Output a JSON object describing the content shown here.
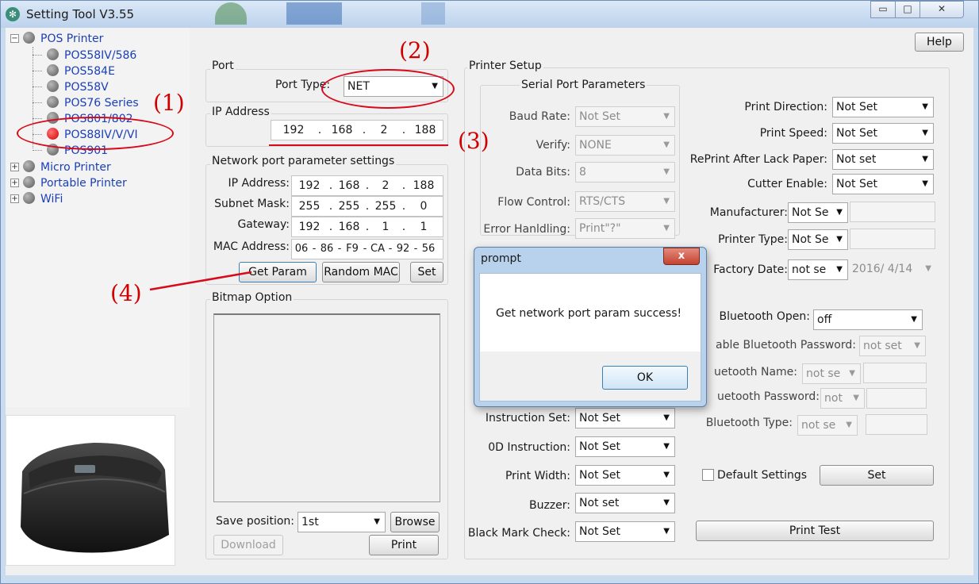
{
  "window": {
    "title": "Setting Tool V3.55",
    "minimize": "▭",
    "maximize": "□",
    "close": "✕",
    "help": "Help"
  },
  "tree": {
    "pos_printer": "POS Printer",
    "children": [
      "POS58IV/586",
      "POS584E",
      "POS58V",
      "POS76 Series",
      "POS801/802",
      "POS88IV/V/VI",
      "POS901"
    ],
    "micro_printer": "Micro Printer",
    "portable_printer": "Portable Printer",
    "wifi": "WiFi"
  },
  "port": {
    "title": "Port",
    "type_label": "Port Type:",
    "type_value": "NET"
  },
  "ip": {
    "title": "IP Address",
    "octets": [
      "192",
      "168",
      "2",
      "188"
    ]
  },
  "network": {
    "title": "Network port parameter settings",
    "ip_label": "IP Address:",
    "ip": [
      "192",
      "168",
      "2",
      "188"
    ],
    "subnet_label": "Subnet Mask:",
    "subnet": [
      "255",
      "255",
      "255",
      "0"
    ],
    "gateway_label": "Gateway:",
    "gateway": [
      "192",
      "168",
      "1",
      "1"
    ],
    "mac_label": "MAC Address:",
    "mac": [
      "06",
      "86",
      "F9",
      "CA",
      "92",
      "56"
    ],
    "get_param": "Get Param",
    "random_mac": "Random MAC",
    "set": "Set"
  },
  "bitmap": {
    "title": "Bitmap Option",
    "save_position_label": "Save position:",
    "save_position_value": "1st",
    "browse": "Browse",
    "download": "Download",
    "print": "Print"
  },
  "printer_setup": {
    "title": "Printer Setup",
    "serial_title": "Serial Port Parameters",
    "baud_label": "Baud Rate:",
    "baud_value": "Not Set",
    "verify_label": "Verify:",
    "verify_value": "NONE",
    "databits_label": "Data Bits:",
    "databits_value": "8",
    "flow_label": "Flow Control:",
    "flow_value": "RTS/CTS",
    "error_label": "Error Hanldling:",
    "error_value": "Print\"?\"",
    "instruction_label": "Instruction Set:",
    "instruction_value": "Not Set",
    "od_label": "0D Instruction:",
    "od_value": "Not Set",
    "width_label": "Print Width:",
    "width_value": "Not Set",
    "buzzer_label": "Buzzer:",
    "buzzer_value": "Not set",
    "blackmark_label": "Black Mark Check:",
    "blackmark_value": "Not Set",
    "direction_label": "Print Direction:",
    "direction_value": "Not Set",
    "speed_label": "Print Speed:",
    "speed_value": "Not Set",
    "reprint_label": "RePrint After Lack Paper:",
    "reprint_value": "Not set",
    "cutter_label": "Cutter Enable:",
    "cutter_value": "Not Set",
    "manufacturer_label": "Manufacturer:",
    "manufacturer_value": "Not Se",
    "type_label": "Printer Type:",
    "type_value": "Not Se",
    "factory_label": "Factory Date:",
    "factory_value": "not se",
    "factory_date": "2016/  4/14",
    "bt_open_label": "Bluetooth Open:",
    "bt_open_value": "off",
    "bt_enable_pw_label": "able Bluetooth Password:",
    "bt_enable_pw_value": "not set",
    "bt_name_label": "uetooth Name:",
    "bt_name_value": "not se",
    "bt_pw_label": "uetooth Password:",
    "bt_pw_value": "not",
    "bt_type_label": "Bluetooth Type:",
    "bt_type_value": "not se",
    "default_settings": "Default Settings",
    "set": "Set",
    "print_test": "Print Test"
  },
  "dialog": {
    "title": "prompt",
    "message": "Get network port param success!",
    "ok": "OK",
    "close": "x"
  },
  "annotations": {
    "a1": "(1)",
    "a2": "(2)",
    "a3": "(3)",
    "a4": "(4)"
  },
  "colors": {
    "annotation_red": "#d8091a",
    "tree_link": "#1b3fb5"
  }
}
